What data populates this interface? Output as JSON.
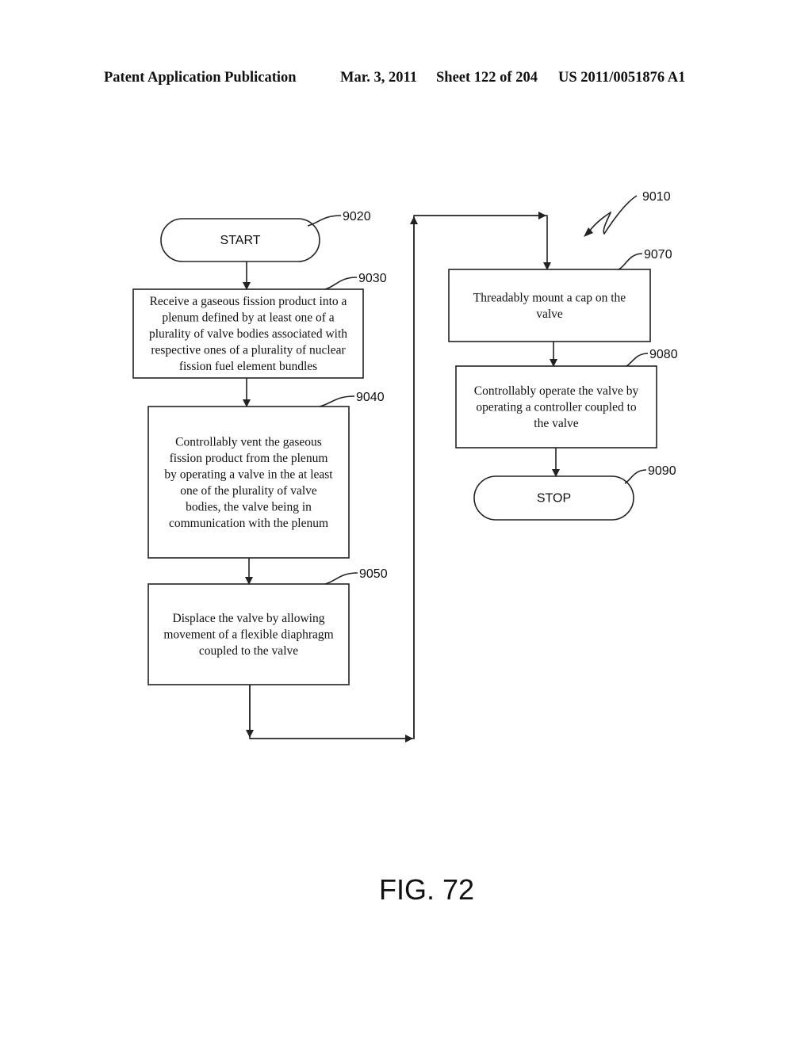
{
  "header": {
    "publication": "Patent Application Publication",
    "date": "Mar. 3, 2011",
    "sheet": "Sheet 122 of 204",
    "patent_number": "US 2011/0051876 A1"
  },
  "diagram": {
    "reference": "9010",
    "figure_label": "FIG. 72",
    "nodes": [
      {
        "id": "9020",
        "type": "terminal",
        "ref": "9020",
        "lines": [
          "START"
        ]
      },
      {
        "id": "9030",
        "type": "process",
        "ref": "9030",
        "lines": [
          "Receive a gaseous fission product into a",
          "plenum defined by at least one of a",
          "plurality of valve bodies associated with",
          "respective ones of a plurality of nuclear",
          "fission fuel element bundles"
        ]
      },
      {
        "id": "9040",
        "type": "process",
        "ref": "9040",
        "lines": [
          "Controllably vent the gaseous",
          "fission product from the plenum",
          "by operating a valve in the at least",
          "one of the plurality of valve",
          "bodies, the valve being in",
          "communication with the plenum"
        ]
      },
      {
        "id": "9050",
        "type": "process",
        "ref": "9050",
        "lines": [
          "Displace the valve by allowing",
          "movement of a flexible diaphragm",
          "coupled to the valve"
        ]
      },
      {
        "id": "9070",
        "type": "process",
        "ref": "9070",
        "lines": [
          "Threadably mount a cap on the",
          "valve"
        ]
      },
      {
        "id": "9080",
        "type": "process",
        "ref": "9080",
        "lines": [
          "Controllably operate the valve by",
          "operating a controller coupled to",
          "the valve"
        ]
      },
      {
        "id": "9090",
        "type": "terminal",
        "ref": "9090",
        "lines": [
          "STOP"
        ]
      }
    ],
    "edges": [
      {
        "from": "9020",
        "to": "9030"
      },
      {
        "from": "9030",
        "to": "9040"
      },
      {
        "from": "9040",
        "to": "9050"
      },
      {
        "from": "9050",
        "to": "9070"
      },
      {
        "from": "9070",
        "to": "9080"
      },
      {
        "from": "9080",
        "to": "9090"
      }
    ]
  }
}
